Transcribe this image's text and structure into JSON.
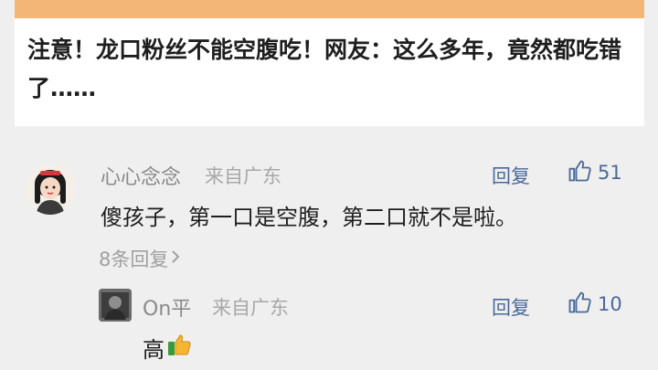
{
  "article": {
    "title": "注意！龙口粉丝不能空腹吃！网友：这么多年，竟然都吃错了……"
  },
  "comment": {
    "user": "心心念念",
    "location": "来自广东",
    "reply_label": "回复",
    "likes": "51",
    "text": "傻孩子，第一口是空腹，第二口就不是啦。",
    "replies_label": "8条回复"
  },
  "reply": {
    "user": "On平",
    "location": "来自广东",
    "reply_label": "回复",
    "likes": "10",
    "text": "高"
  },
  "icons": {
    "like": "thumbs-up-outline-icon",
    "chevron": "chevron-right-icon",
    "emoji": "thumbs-up-emoji-icon"
  },
  "colors": {
    "banner": "#f3b676",
    "link": "#4a6a9a",
    "meta": "#a8a8a8"
  }
}
